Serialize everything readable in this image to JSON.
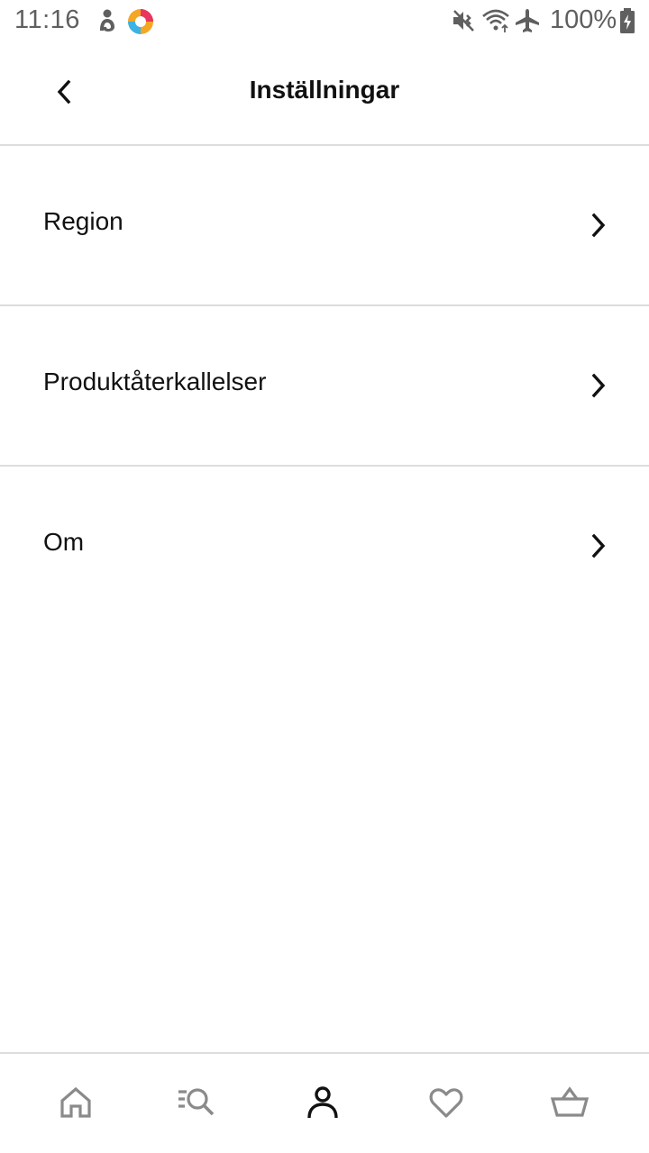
{
  "status_bar": {
    "time": "11:16",
    "battery": "100%",
    "icons": [
      "notification-app-icon",
      "browser-app-icon",
      "muted-vibrate-icon",
      "wifi-icon",
      "airplane-mode-icon",
      "battery-charging-icon"
    ]
  },
  "header": {
    "title": "Inställningar",
    "back_icon": "chevron-left-icon"
  },
  "settings": {
    "items": [
      {
        "label": "Region",
        "icon": "chevron-right-icon"
      },
      {
        "label": "Produktåterkallelser",
        "icon": "chevron-right-icon"
      },
      {
        "label": "Om",
        "icon": "chevron-right-icon"
      }
    ]
  },
  "bottom_nav": {
    "items": [
      {
        "icon": "home-icon",
        "active": false
      },
      {
        "icon": "search-products-icon",
        "active": false
      },
      {
        "icon": "profile-icon",
        "active": true
      },
      {
        "icon": "heart-icon",
        "active": false
      },
      {
        "icon": "basket-icon",
        "active": false
      }
    ]
  },
  "colors": {
    "text_primary": "#111111",
    "status_text": "#5f5f5f",
    "nav_inactive": "#8a8a8a",
    "divider": "#dddddd",
    "background": "#ffffff"
  }
}
